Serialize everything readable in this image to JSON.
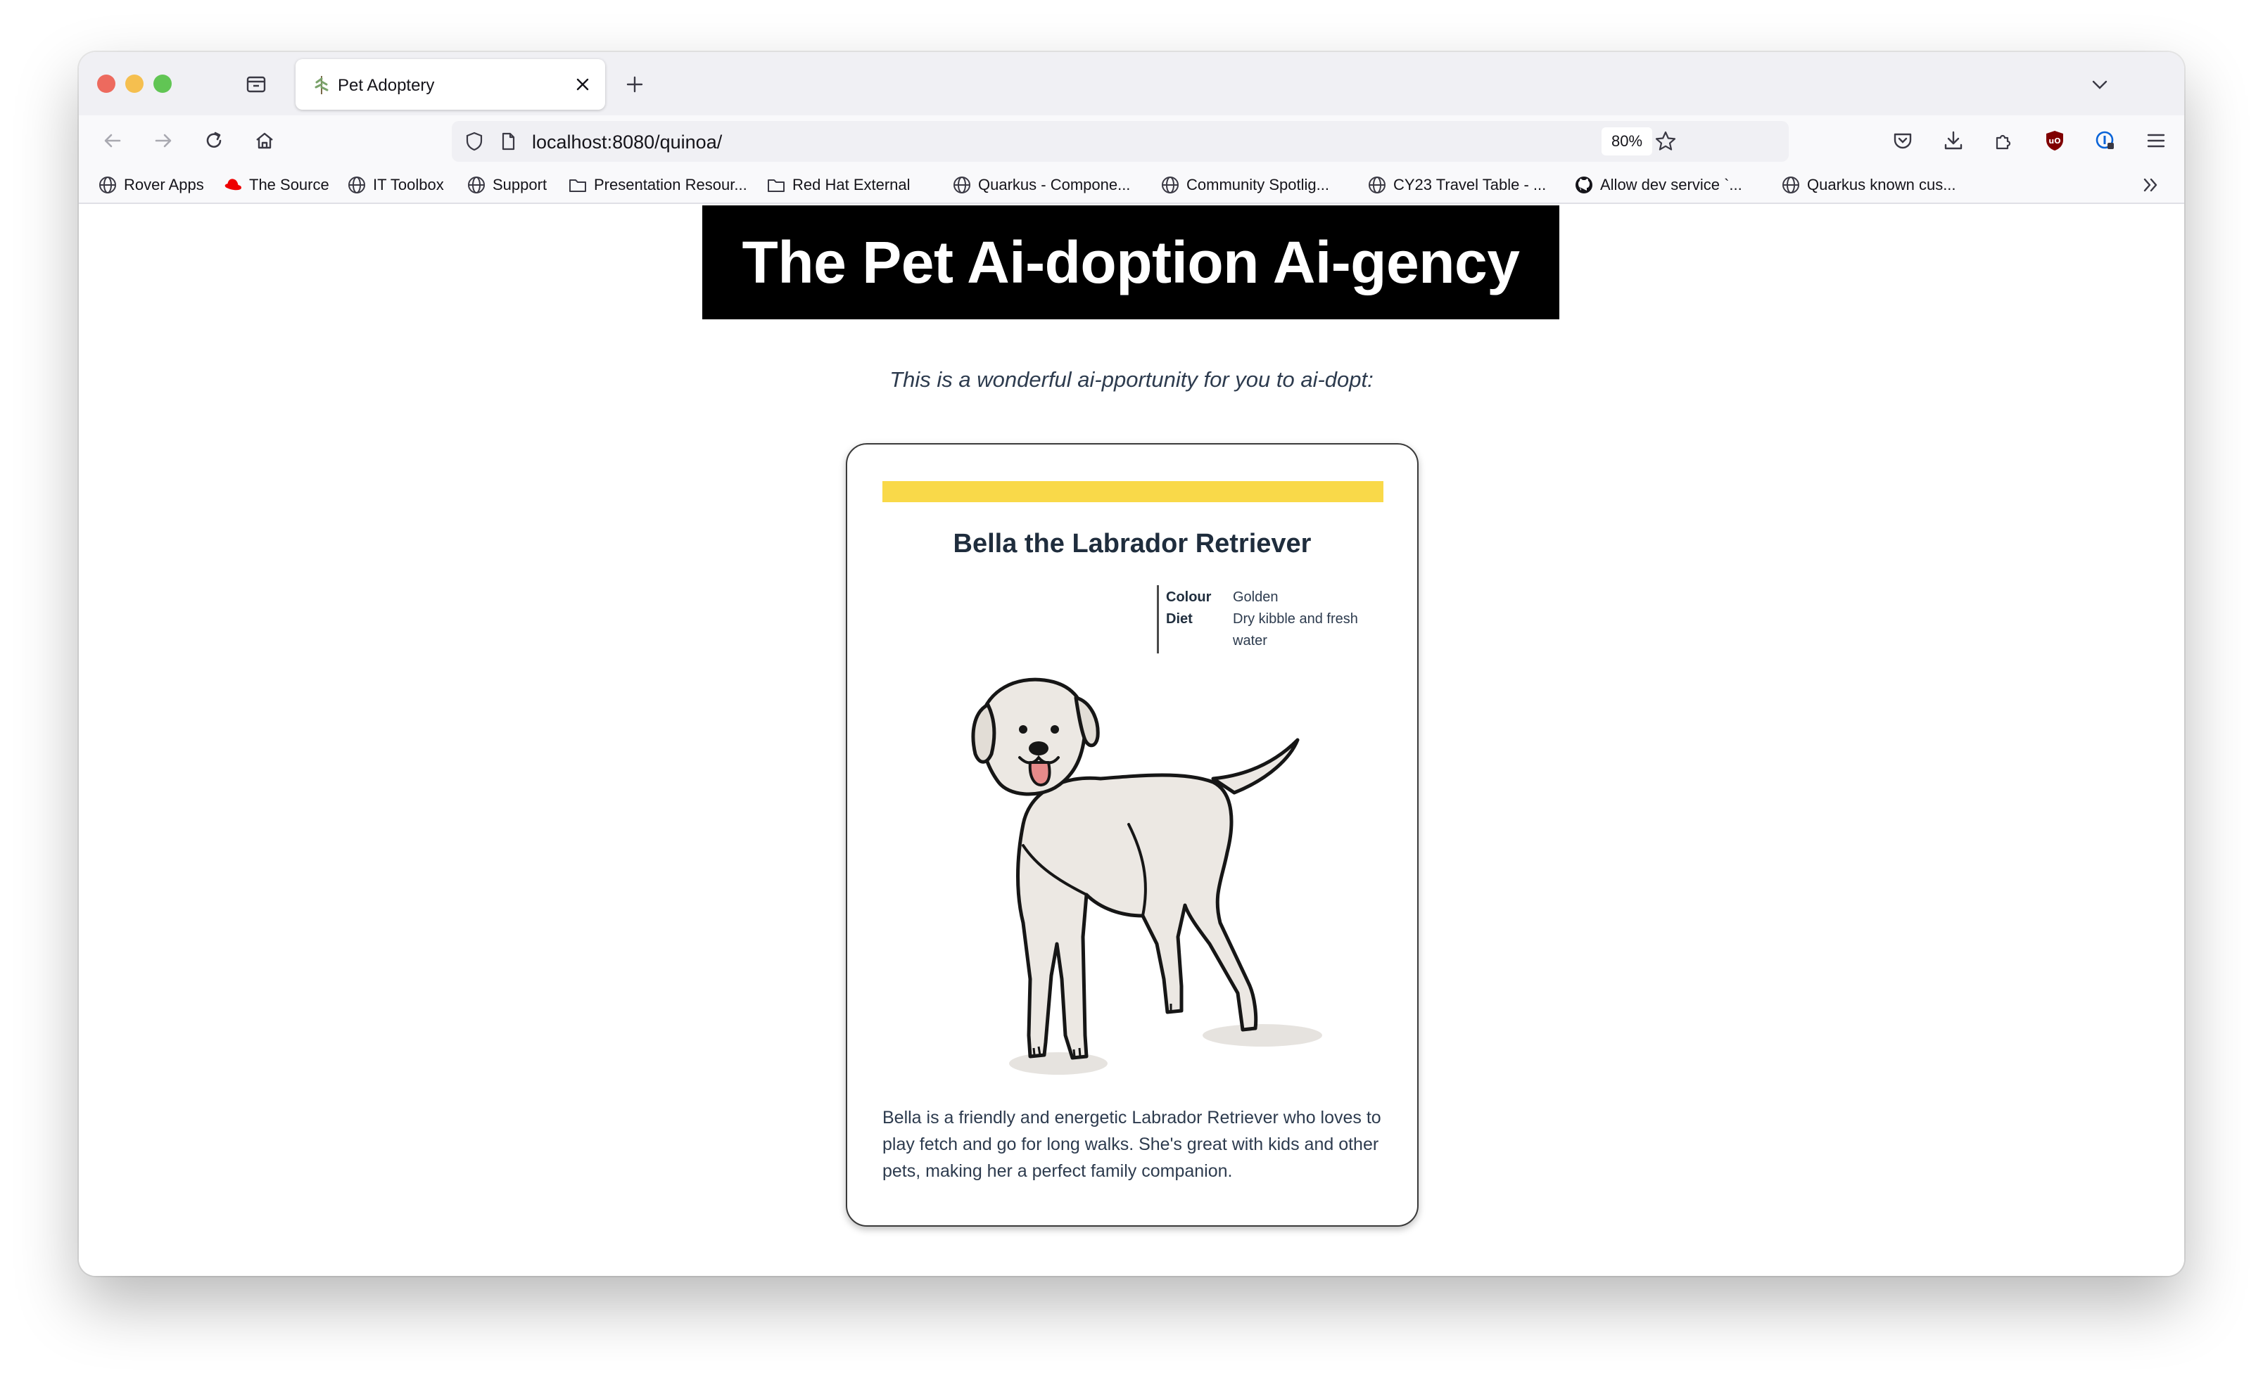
{
  "browser": {
    "tab": {
      "title": "Pet Adoptery",
      "favicon": "pet-tree-favicon"
    },
    "url": "localhost:8080/quinoa/",
    "zoom": "80%",
    "bookmarks": [
      {
        "label": "Rover Apps",
        "icon": "globe-icon"
      },
      {
        "label": "The Source",
        "icon": "redhat-icon"
      },
      {
        "label": "IT Toolbox",
        "icon": "globe-icon"
      },
      {
        "label": "Support",
        "icon": "globe-icon"
      },
      {
        "label": "Presentation Resour...",
        "icon": "folder-icon"
      },
      {
        "label": "Red Hat External",
        "icon": "folder-icon"
      },
      {
        "label": "Quarkus - Compone...",
        "icon": "globe-icon"
      },
      {
        "label": "Community Spotlig...",
        "icon": "globe-icon"
      },
      {
        "label": "CY23 Travel Table - ...",
        "icon": "globe-icon"
      },
      {
        "label": "Allow dev service `...",
        "icon": "github-icon"
      },
      {
        "label": "Quarkus known cus...",
        "icon": "globe-icon"
      }
    ]
  },
  "page": {
    "title": "The Pet Ai-doption Ai-gency",
    "intro": "This is a wonderful ai-pportunity for you to ai-dopt:",
    "pet": {
      "name": "Bella the Labrador Retriever",
      "facts": [
        {
          "key": "Colour",
          "value": "Golden"
        },
        {
          "key": "Diet",
          "value": "Dry kibble and fresh water"
        }
      ],
      "description": "Bella is a friendly and energetic Labrador Retriever who loves to play fetch and go for long walks. She's great with kids and other pets, making her a perfect family companion.",
      "band_color": "#f9d949",
      "image": "labrador-illustration"
    }
  }
}
